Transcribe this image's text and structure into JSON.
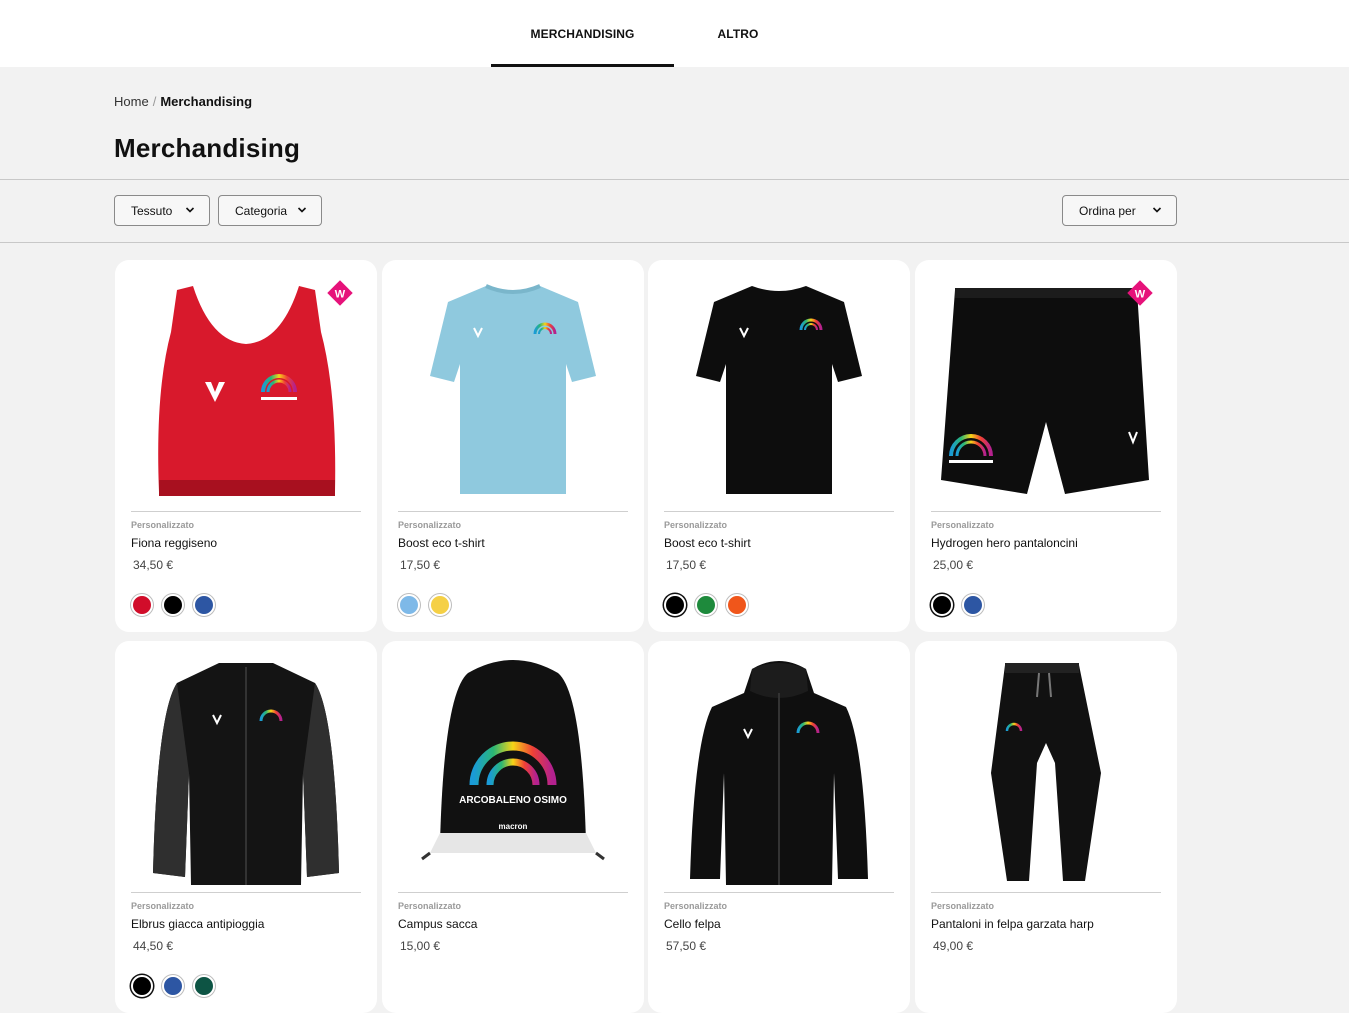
{
  "nav": {
    "tabs": [
      {
        "label": "MERCHANDISING",
        "active": true
      },
      {
        "label": "ALTRO",
        "active": false
      }
    ]
  },
  "breadcrumb": {
    "home": "Home",
    "separator": "/",
    "current": "Merchandising"
  },
  "page": {
    "title": "Merchandising"
  },
  "filters": {
    "tessuto": "Tessuto",
    "categoria": "Categoria",
    "sort": "Ordina per"
  },
  "products": [
    {
      "kind": "Personalizzato",
      "name": "Fiona reggiseno",
      "price": "34,50 €",
      "badge": "W",
      "image": "red-sports-bra",
      "colors": [
        "#d10d2a",
        "#000000",
        "#2d56a3"
      ]
    },
    {
      "kind": "Personalizzato",
      "name": "Boost eco t-shirt",
      "price": "17,50 €",
      "image": "light-blue-tshirt",
      "colors": [
        "#7eb9e8",
        "#f5d046"
      ]
    },
    {
      "kind": "Personalizzato",
      "name": "Boost eco t-shirt",
      "price": "17,50 €",
      "image": "black-tshirt",
      "colors": [
        "#000000",
        "#1e8a3c",
        "#f0561b"
      ]
    },
    {
      "kind": "Personalizzato",
      "name": "Hydrogen hero pantaloncini",
      "price": "25,00 €",
      "badge": "W",
      "image": "black-shorts",
      "colors": [
        "#000000",
        "#2d56a3"
      ]
    },
    {
      "kind": "Personalizzato",
      "name": "Elbrus giacca antipioggia",
      "price": "44,50 €",
      "image": "black-rain-jacket",
      "colors": [
        "#000000",
        "#2d56a3",
        "#0d5444"
      ]
    },
    {
      "kind": "Personalizzato",
      "name": "Campus sacca",
      "price": "15,00 €",
      "image": "black-gym-sack",
      "sack_text": "ARCOBALENO OSIMO",
      "sack_brand": "macron",
      "colors": []
    },
    {
      "kind": "Personalizzato",
      "name": "Cello felpa",
      "price": "57,50 €",
      "image": "black-hoodie",
      "colors": []
    },
    {
      "kind": "Personalizzato",
      "name": "Pantaloni in felpa garzata harp",
      "price": "49,00 €",
      "image": "black-sweatpants",
      "colors": []
    }
  ],
  "colors": {
    "accent": "#e6127a",
    "dark": "#111111",
    "background": "#f2f2f2"
  }
}
